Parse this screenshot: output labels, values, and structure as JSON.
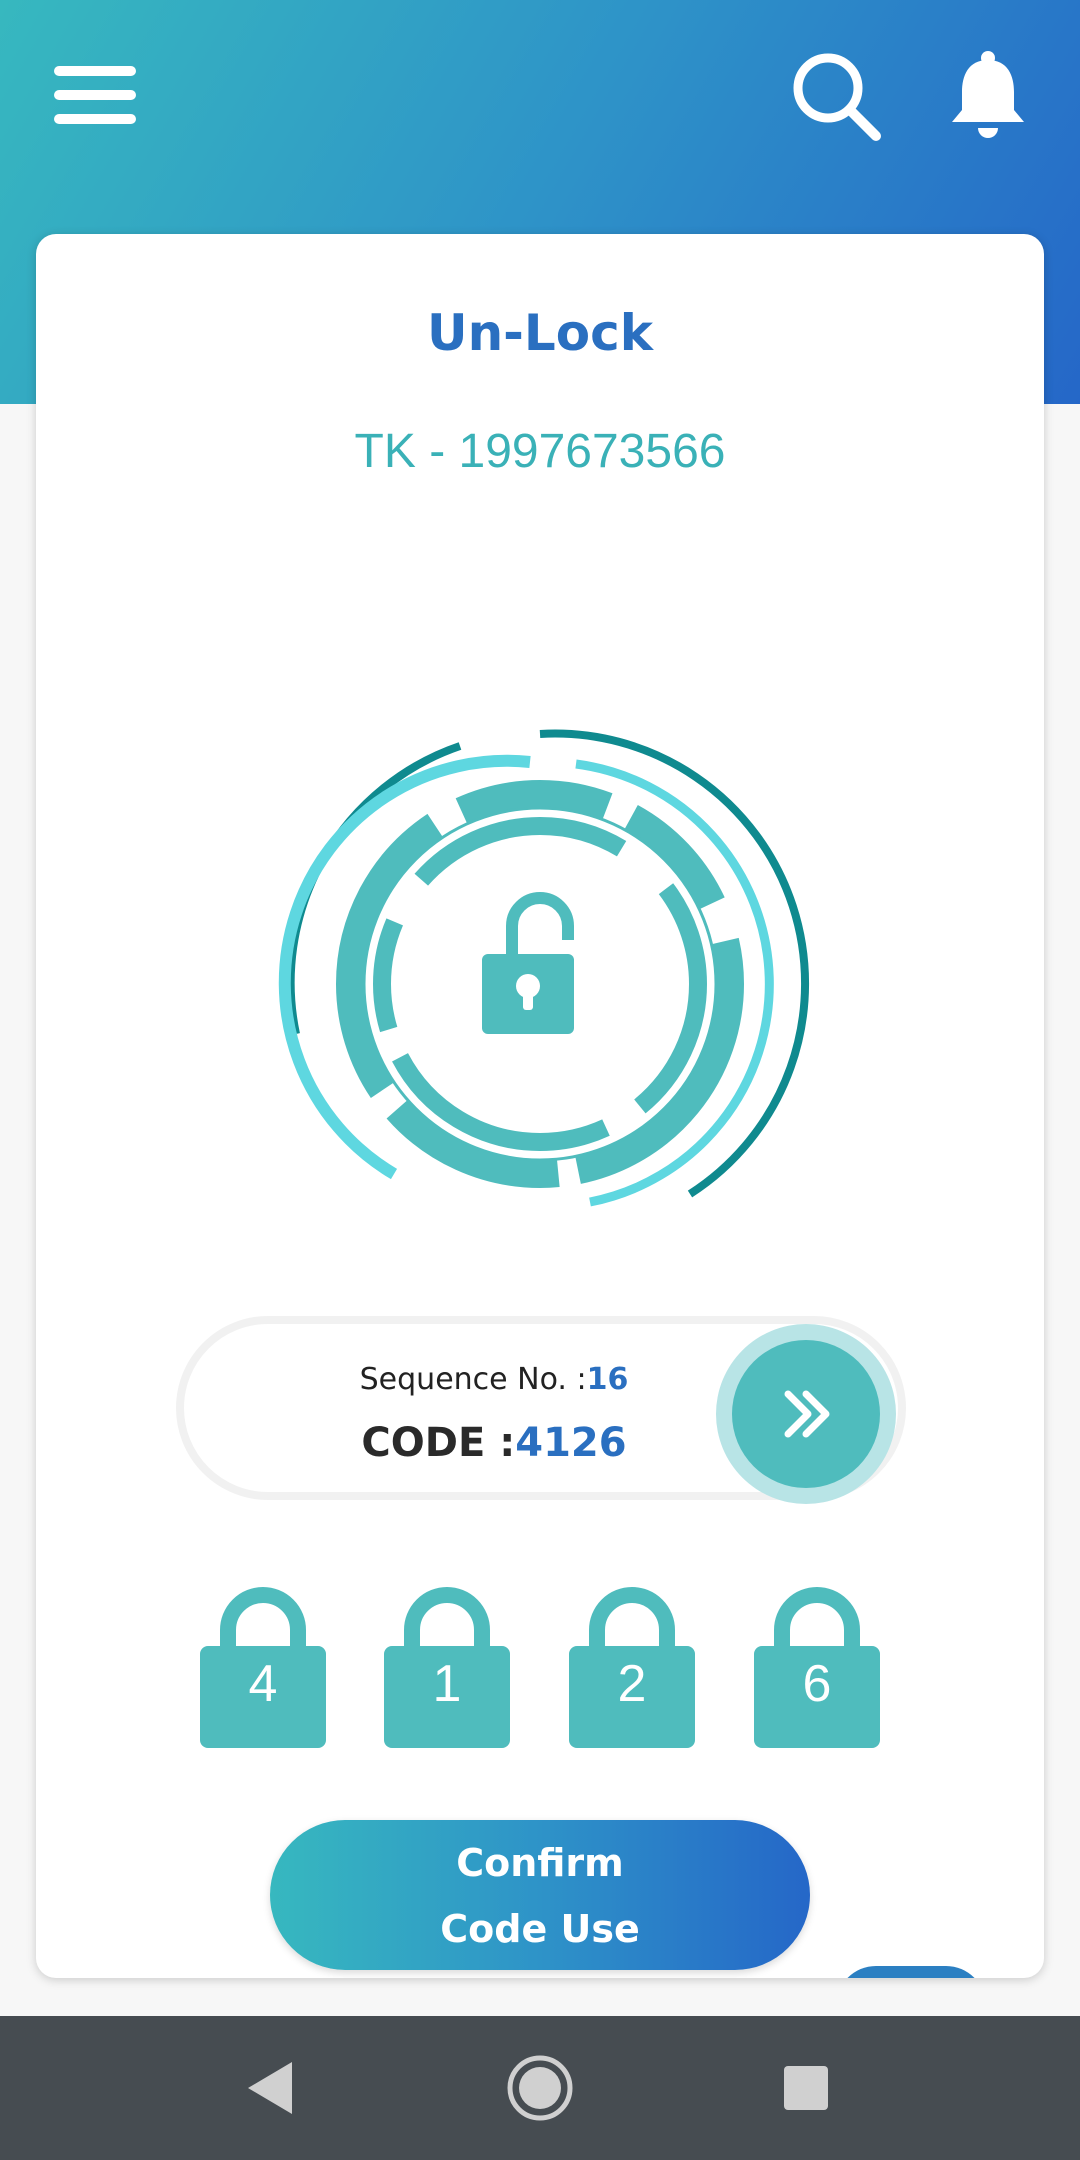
{
  "header": {
    "menu_icon": "hamburger-menu-icon",
    "search_icon": "search-icon",
    "notification_icon": "bell-icon",
    "gradient_start": "#37b8bf",
    "gradient_end": "#2567c8"
  },
  "card": {
    "title": "Un-Lock",
    "account": "TK - 1997673566",
    "lock_icon": "unlock-padlock-icon"
  },
  "sequence": {
    "label": "Sequence No. :",
    "value": "16",
    "code_label": "CODE :",
    "code_value": "4126",
    "next_icon": "double-chevron-right-icon"
  },
  "digits": [
    "4",
    "1",
    "2",
    "6"
  ],
  "confirm": {
    "line1": "Confirm",
    "line2": "Code Use"
  },
  "navbar": {
    "back_icon": "back-triangle-icon",
    "home_icon": "home-circle-icon",
    "recents_icon": "recents-square-icon"
  },
  "colors": {
    "accent_teal": "#4fbcbd",
    "accent_blue": "#2a6fc0",
    "nav_bar": "#464c51"
  }
}
